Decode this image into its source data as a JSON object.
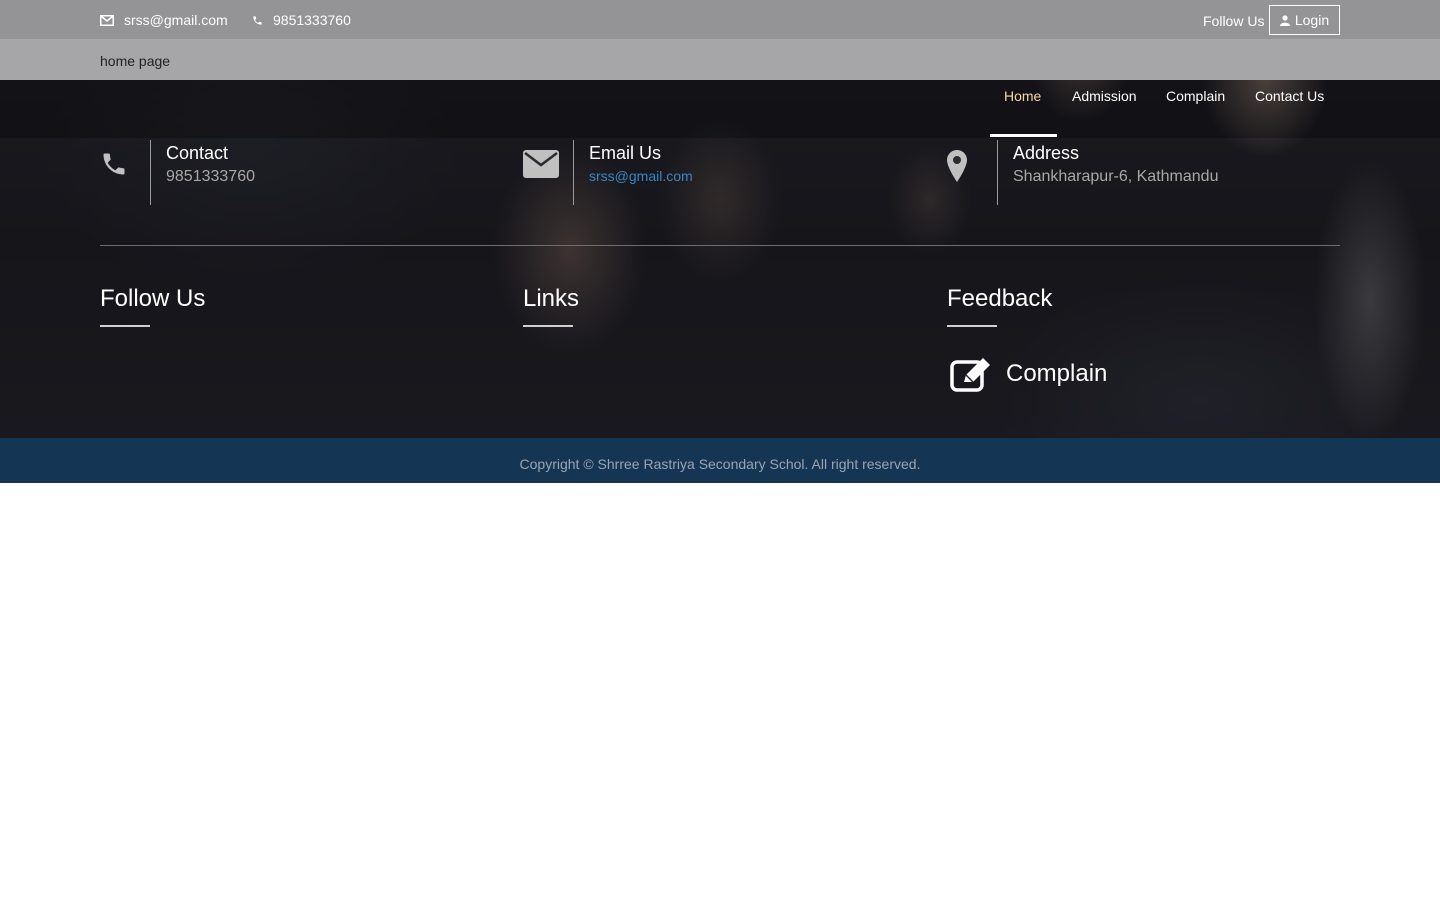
{
  "topbar": {
    "email": "srss@gmail.com",
    "phone": "9851333760",
    "follow_label": "Follow Us",
    "login_label": "Login"
  },
  "brand": {
    "title": "home page"
  },
  "nav": {
    "items": [
      {
        "label": "Home",
        "active": true
      },
      {
        "label": "Admission"
      },
      {
        "label": "Complain"
      },
      {
        "label": "Contact Us"
      }
    ]
  },
  "info": {
    "contact": {
      "title": "Contact",
      "value": "9851333760",
      "icon": "phone-icon"
    },
    "email": {
      "title": "Email Us",
      "value": "srss@gmail.com",
      "icon": "envelope-icon"
    },
    "address": {
      "title": "Address",
      "value": "Shankharapur-6, Kathmandu",
      "icon": "map-marker-icon"
    }
  },
  "columns": {
    "follow_title": "Follow Us",
    "links_title": "Links",
    "feedback_title": "Feedback",
    "complain_label": "Complain"
  },
  "footer": {
    "copyright": "Copyright © Shrree Rastriya Secondary Schol. All right reserved."
  },
  "colors": {
    "nav_active": "#f3d9a4",
    "link_blue": "#3a86c4",
    "copyright_bg": "#143553"
  }
}
